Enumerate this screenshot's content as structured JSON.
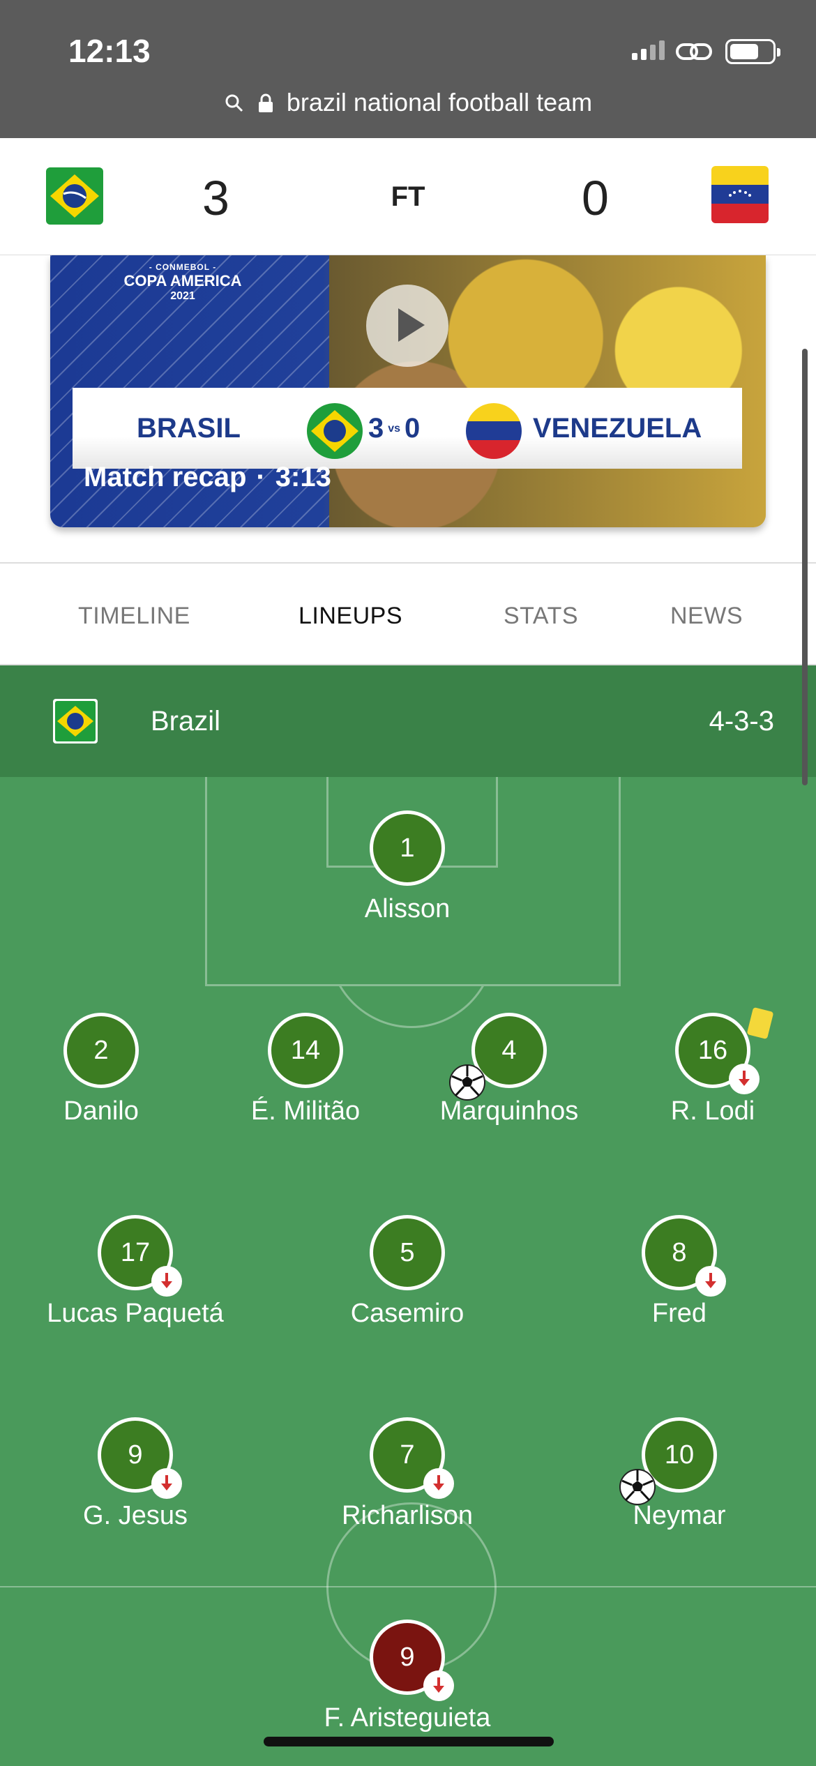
{
  "status": {
    "time": "12:13"
  },
  "browser": {
    "url_text": "brazil national football team"
  },
  "match": {
    "home_score": "3",
    "status": "FT",
    "away_score": "0"
  },
  "video": {
    "tournament_small": "- CONMEBOL -",
    "tournament": "COPA AMERICA",
    "year": "2021",
    "home": "BRASIL",
    "home_goals": "3",
    "vs": "vs",
    "away_goals": "0",
    "away": "VENEZUELA",
    "caption": "Match recap",
    "dot": "·",
    "duration": "3:13"
  },
  "tabs": [
    "TIMELINE",
    "LINEUPS",
    "STATS",
    "NEWS"
  ],
  "active_tab": "LINEUPS",
  "team": {
    "name": "Brazil",
    "formation": "4-3-3"
  },
  "lineup": {
    "goalkeeper": {
      "number": "1",
      "name": "Alisson"
    },
    "defenders": [
      {
        "number": "2",
        "name": "Danilo"
      },
      {
        "number": "14",
        "name": "É. Militão"
      },
      {
        "number": "4",
        "name": "Marquinhos"
      },
      {
        "number": "16",
        "name": "R. Lodi"
      }
    ],
    "midfielders": [
      {
        "number": "17",
        "name": "Lucas Paquetá"
      },
      {
        "number": "5",
        "name": "Casemiro"
      },
      {
        "number": "8",
        "name": "Fred"
      }
    ],
    "forwards": [
      {
        "number": "9",
        "name": "G. Jesus"
      },
      {
        "number": "7",
        "name": "Richarlison"
      },
      {
        "number": "10",
        "name": "Neymar"
      }
    ],
    "opponent_forward": {
      "number": "9",
      "name": "F. Aristeguieta"
    }
  },
  "colors": {
    "pitch": "#4a9a5b",
    "team_header": "#3a8248",
    "player_circle": "#3c7d22",
    "opponent_circle": "#7a1410",
    "sub_arrow": "#d32f2f",
    "yellow_card": "#f4d83a"
  }
}
